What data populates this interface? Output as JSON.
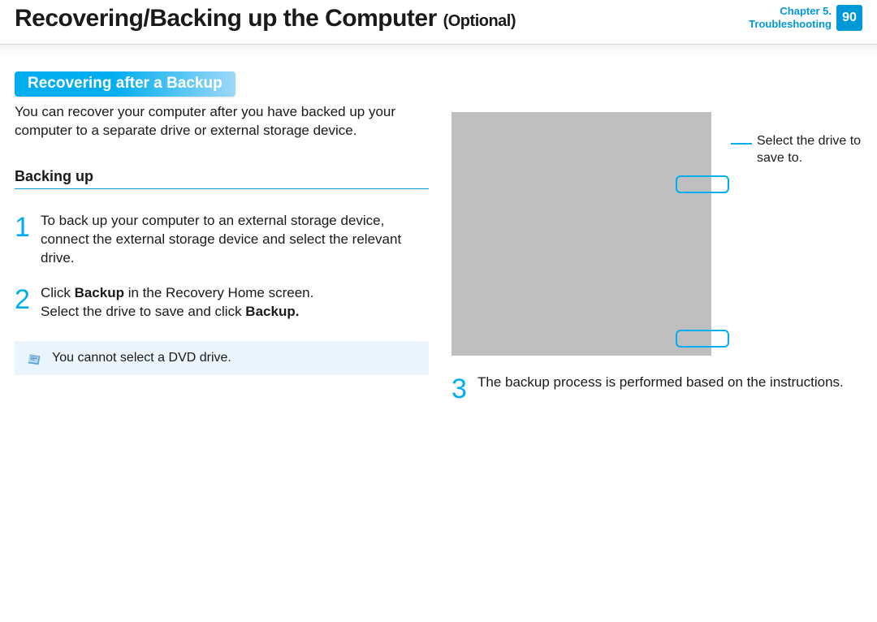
{
  "header": {
    "title": "Recovering/Backing up the Computer",
    "subtitle": "(Optional)",
    "chapter": "Chapter 5.",
    "section": "Troubleshooting",
    "page": "90"
  },
  "section_heading": "Recovering after a Backup",
  "intro": "You can recover your computer after you have backed up your computer to a separate drive or external storage device.",
  "sub_heading": "Backing up",
  "steps": [
    {
      "num": "1",
      "text": "To back up your computer to an external storage device, connect the external storage device and select the relevant drive."
    },
    {
      "num": "2",
      "text_a": "Click ",
      "bold_a": "Backup",
      "text_b": " in the Recovery Home screen.",
      "line2_a": "Select the drive to save and click ",
      "line2_bold": "Backup.",
      "line2_b": ""
    }
  ],
  "note": "You cannot select a DVD drive.",
  "callout_label": "Select the drive to save to.",
  "step3": {
    "num": "3",
    "text": "The backup process is performed based on the instructions."
  }
}
